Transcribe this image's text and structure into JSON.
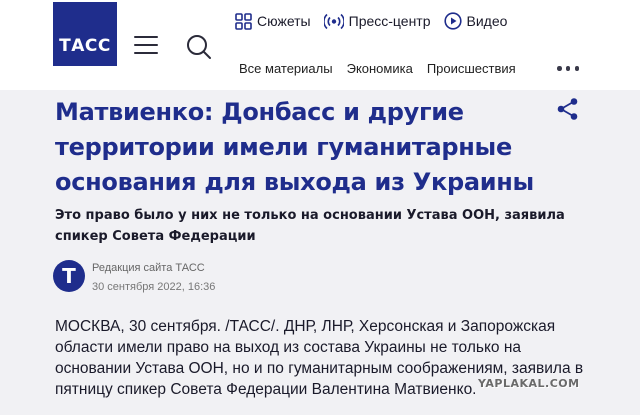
{
  "header": {
    "logo_text": "ТАСС",
    "topnav": [
      {
        "label": "Сюжеты",
        "icon": "grid-icon"
      },
      {
        "label": "Пресс-центр",
        "icon": "broadcast-icon"
      },
      {
        "label": "Видео",
        "icon": "play-icon"
      }
    ],
    "subnav": [
      "Все материалы",
      "Экономика",
      "Происшествия"
    ]
  },
  "article": {
    "headline": "Матвиенко: Донбасс и другие территории имели гуманитарные основания для выхода из Украины",
    "lead": "Это право было у них не только на основании Устава ООН, заявила спикер Совета Федерации",
    "author": "Редакция сайта ТАСС",
    "author_initial": "Т",
    "date": "30 сентября 2022, 16:36",
    "body": "МОСКВА, 30 сентября. /ТАСС/. ДНР, ЛНР, Херсонская и Запорожская области имели право на выход из состава Украины не только на основании Устава ООН, но и по гуманитарным соображениям, заявила в пятницу спикер Совета Федерации Валентина Матвиенко."
  },
  "watermark": "YAPLAKAL.COM",
  "colors": {
    "brand": "#1f2d8c",
    "background": "#f1f1f4",
    "header_bg": "#ffffff"
  }
}
